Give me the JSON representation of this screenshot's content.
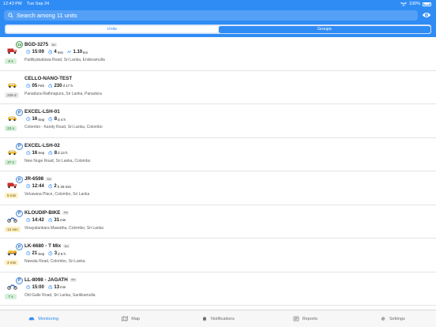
{
  "status_bar": {
    "time": "12:43 PM",
    "date": "Tue Sep 24",
    "battery": "100%"
  },
  "search": {
    "placeholder": "Search among 11 units"
  },
  "segments": {
    "units": "Units",
    "groups": "Groups"
  },
  "units": [
    {
      "name": "BGD-3275",
      "tag": "6m",
      "badge": "15",
      "badge_type": "green",
      "vehicle": "truck-red",
      "meta": [
        {
          "icon": "clock-icon",
          "value": "15:09",
          "sub": ""
        },
        {
          "icon": "timer-icon",
          "value": "4",
          "sub": " min"
        },
        {
          "icon": "distance-icon",
          "value": "1.10",
          "sub": " km"
        }
      ],
      "address": "Padiliyatuduwa Road, Sri Lanka, Enderamulla",
      "chip": "8 s",
      "chip_color": "green"
    },
    {
      "name": "CELLO-NANO-TEST",
      "tag": "",
      "badge": "",
      "badge_type": "",
      "vehicle": "car-yellow",
      "meta": [
        {
          "icon": "clock-icon",
          "value": "05",
          "sub": " Feb"
        },
        {
          "icon": "timer-icon",
          "value": "230",
          "sub": " d 17 h"
        }
      ],
      "address": "Panadura-Rathnapura, Sri Lanka, Panadura",
      "chip": "228 d",
      "chip_color": "grey"
    },
    {
      "name": "EXCEL-LSH-01",
      "tag": "",
      "badge": "P",
      "badge_type": "blue",
      "vehicle": "car-yellow",
      "meta": [
        {
          "icon": "clock-icon",
          "value": "16",
          "sub": " Sep"
        },
        {
          "icon": "timer-icon",
          "value": "8",
          "sub": " d 4 h"
        }
      ],
      "address": "Colombo - Kandy Road, Sri Lanka, Colombo",
      "chip": "22 s",
      "chip_color": "green"
    },
    {
      "name": "EXCEL-LSH-02",
      "tag": "",
      "badge": "P",
      "badge_type": "blue",
      "vehicle": "car-yellow",
      "meta": [
        {
          "icon": "clock-icon",
          "value": "16",
          "sub": " Sep"
        },
        {
          "icon": "timer-icon",
          "value": "8",
          "sub": " d 13 h"
        }
      ],
      "address": "New Nuge Road, Sri Lanka, Colombo",
      "chip": "37 s",
      "chip_color": "green"
    },
    {
      "name": "JR-6598",
      "tag": "6m",
      "badge": "P",
      "badge_type": "blue",
      "vehicle": "truck-red",
      "meta": [
        {
          "icon": "clock-icon",
          "value": "12:44",
          "sub": ""
        },
        {
          "icon": "timer-icon",
          "value": "2",
          "sub": " h 29 min"
        }
      ],
      "address": "Veluwana Place, Colombo, Sri Lanka",
      "chip": "5 min",
      "chip_color": "yellow"
    },
    {
      "name": "KLOUDIP-BIKE",
      "tag": "6m",
      "badge": "P",
      "badge_type": "blue",
      "vehicle": "bike-blue",
      "meta": [
        {
          "icon": "clock-icon",
          "value": "14:42",
          "sub": ""
        },
        {
          "icon": "timer-icon",
          "value": "31",
          "sub": " min"
        }
      ],
      "address": "Vinayalankara Mawatha, Colombo, Sri Lanka",
      "chip": "13 min",
      "chip_color": "yellow"
    },
    {
      "name": "LK-6680 - T Mix",
      "tag": "6m",
      "badge": "P",
      "badge_type": "blue",
      "vehicle": "mixer-yellow",
      "meta": [
        {
          "icon": "clock-icon",
          "value": "21",
          "sub": " Sep"
        },
        {
          "icon": "timer-icon",
          "value": "3",
          "sub": " d 6 h"
        }
      ],
      "address": "Nawala Road, Colombo, Sri Lanka",
      "chip": "4 min",
      "chip_color": "yellow"
    },
    {
      "name": "LL-8098 - JAGATH",
      "tag": "6m",
      "badge": "P",
      "badge_type": "blue",
      "vehicle": "bike-blue",
      "meta": [
        {
          "icon": "clock-icon",
          "value": "15:00",
          "sub": ""
        },
        {
          "icon": "timer-icon",
          "value": "13",
          "sub": " min"
        }
      ],
      "address": "Old Galle Road, Sri Lanka, Sarikkamulla",
      "chip": "7 s",
      "chip_color": "green"
    }
  ],
  "tabs": [
    {
      "label": "Monitoring",
      "icon": "car-icon",
      "active": true
    },
    {
      "label": "Map",
      "icon": "map-icon",
      "active": false
    },
    {
      "label": "Notifications",
      "icon": "bell-icon",
      "active": false
    },
    {
      "label": "Reports",
      "icon": "reports-icon",
      "active": false
    },
    {
      "label": "Settings",
      "icon": "gear-icon",
      "active": false
    }
  ],
  "colors": {
    "accent": "#2f8cf5",
    "header": "#2f8cf5",
    "chip_green": "#d6f0d9",
    "chip_yellow": "#fdf0c4"
  }
}
